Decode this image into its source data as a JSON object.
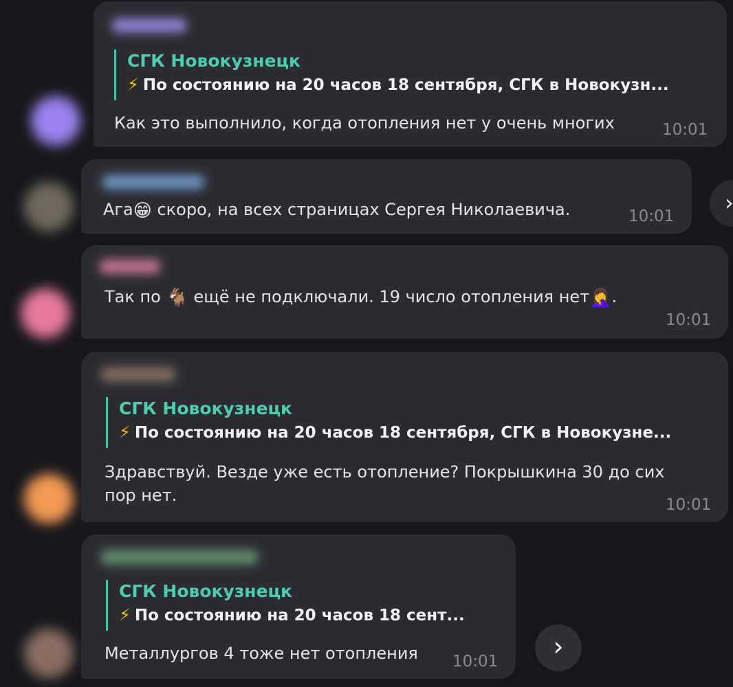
{
  "messages": [
    {
      "reply": {
        "name": "СГК Новокузнецк",
        "text": "По состоянию на 20 часов 18 сентября, СГК в Новокузн..."
      },
      "text": "Как это выполнило, когда отопления нет у очень многих",
      "time": "10:01"
    },
    {
      "text_before": "Ага",
      "emoji": "😁",
      "text_after": " скоро, на всех страницах Сергея Николаевича.",
      "time": "10:01"
    },
    {
      "text_before": "Так по ",
      "emoji": "🐐",
      "text_middle": " ещё не подключали. 19 число отопления нет",
      "emoji2": "🤦‍♀️",
      "text_after": ".",
      "time": "10:01"
    },
    {
      "reply": {
        "name": "СГК Новокузнецк",
        "text": "По состоянию на 20 часов 18 сентября, СГК в Новокузне..."
      },
      "text": "Здравствуй. Везде уже есть отопление? Покрышкина 30 до сих пор нет.",
      "time": "10:01"
    },
    {
      "reply": {
        "name": "СГК Новокузнецк",
        "text": "По состоянию на 20 часов 18 сент..."
      },
      "text": "Металлургов 4 тоже нет отопления",
      "time": "10:01"
    }
  ],
  "icons": {
    "bolt": "⚡",
    "forward": "›",
    "forward_partial": "›"
  },
  "colors": {
    "background": "#17171b",
    "bubble": "#2b2b31",
    "reply_accent": "#40c4a8",
    "reply_name": "#4ecbb0",
    "time": "#8b8b92"
  }
}
